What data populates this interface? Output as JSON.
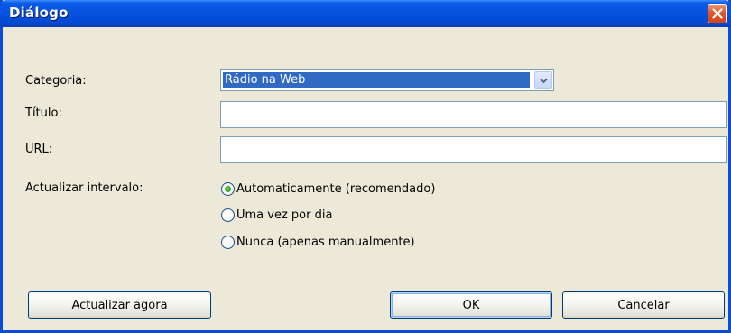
{
  "window": {
    "title": "Diálogo"
  },
  "form": {
    "category_label": "Categoria:",
    "category_value": "Rádio na Web",
    "title_label": "Título:",
    "title_value": "",
    "url_label": "URL:",
    "url_value": "",
    "interval_label": "Actualizar intervalo:",
    "interval_options": [
      {
        "label": "Automaticamente (recomendado)",
        "checked": true
      },
      {
        "label": "Uma vez por dia",
        "checked": false
      },
      {
        "label": "Nunca (apenas manualmente)",
        "checked": false
      }
    ]
  },
  "buttons": {
    "update_now": "Actualizar agora",
    "ok": "OK",
    "cancel": "Cancelar"
  },
  "icons": {
    "close": "close-icon",
    "dropdown": "chevron-down-icon"
  },
  "colors": {
    "titlebar": "#0653e0",
    "close": "#d34419",
    "selection": "#316ac5",
    "background": "#ece9d8"
  }
}
